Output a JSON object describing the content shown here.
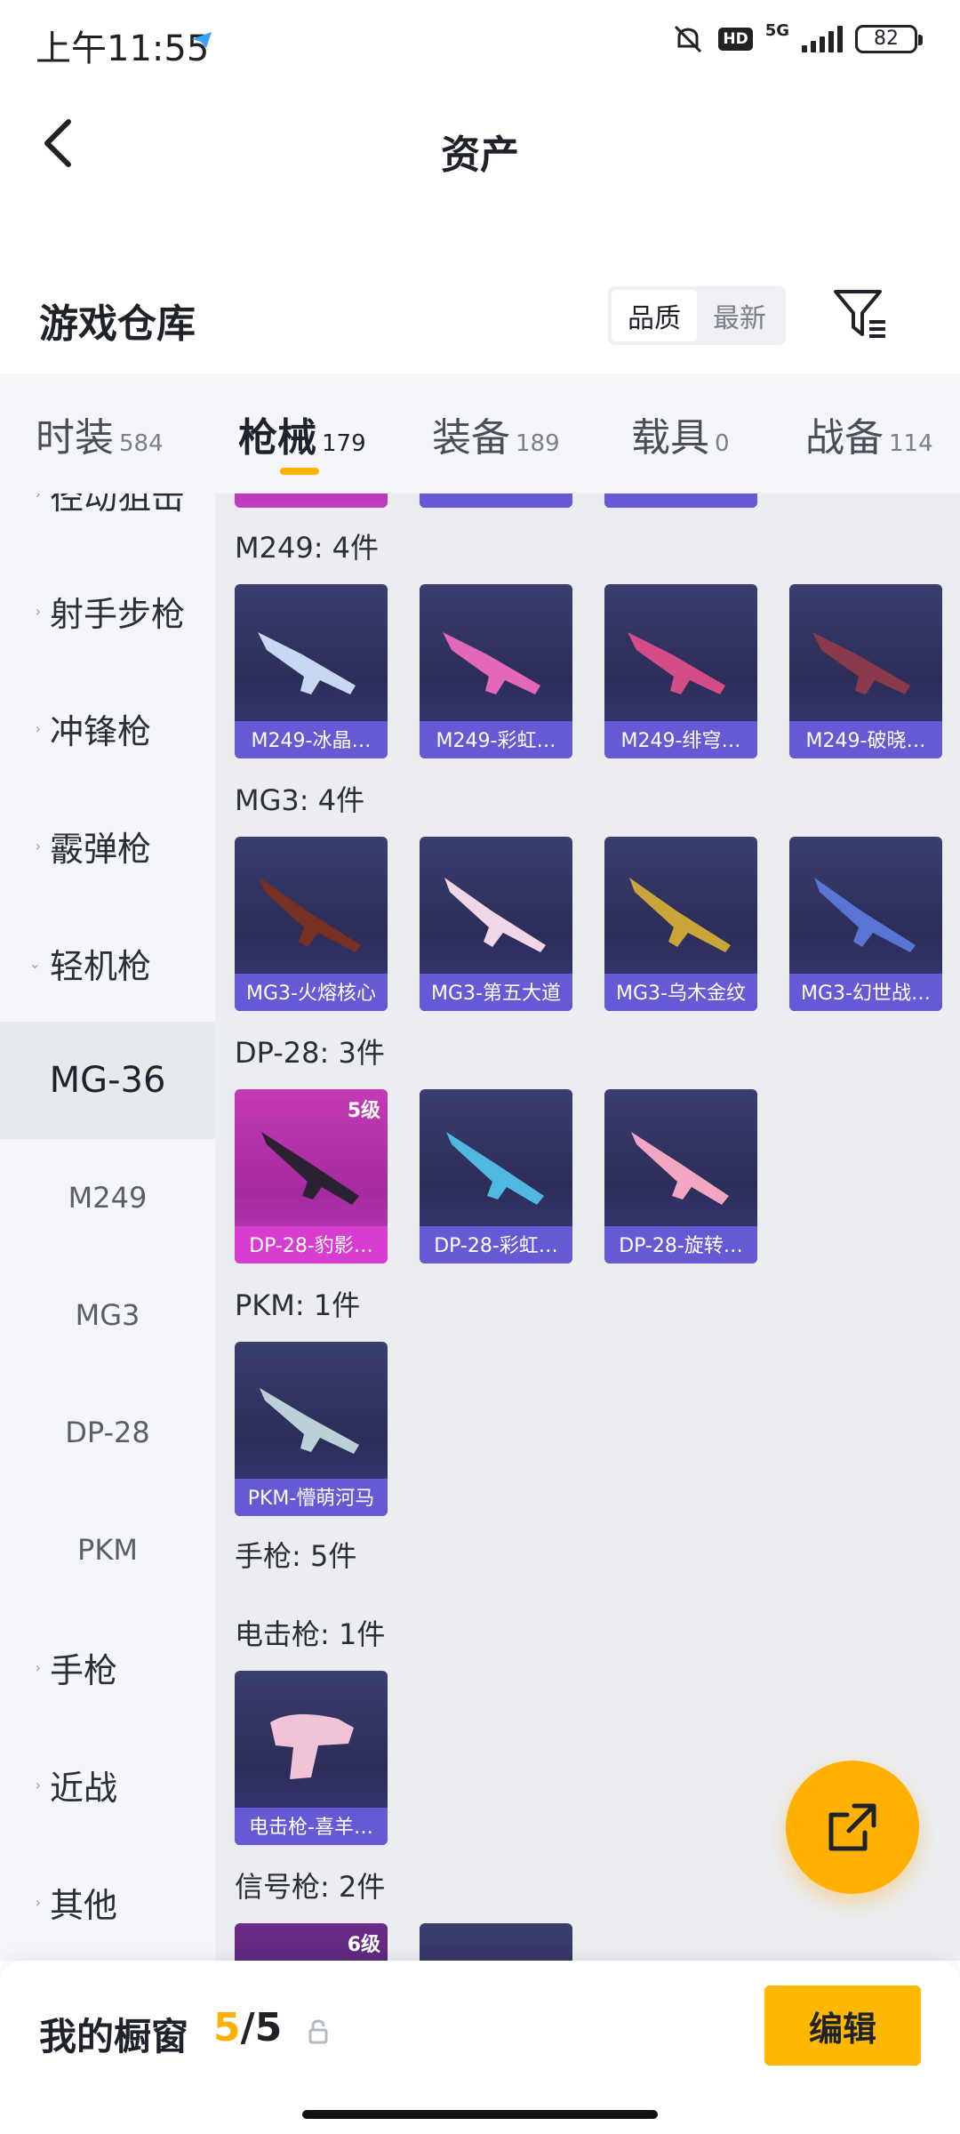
{
  "status_bar": {
    "time": "上午11:55",
    "hd": "HD",
    "network": "5G",
    "battery": "82"
  },
  "header": {
    "title": "资产"
  },
  "section": {
    "title": "游戏仓库",
    "sort_options": [
      "品质",
      "最新"
    ],
    "active_sort": "品质"
  },
  "tabs": [
    {
      "label": "时装",
      "count": "584"
    },
    {
      "label": "枪械",
      "count": "179",
      "active": true
    },
    {
      "label": "装备",
      "count": "189"
    },
    {
      "label": "载具",
      "count": "0"
    },
    {
      "label": "战备",
      "count": "114"
    }
  ],
  "sidebar": {
    "top_partial": "径动狙击",
    "items": [
      {
        "label": "射手步枪"
      },
      {
        "label": "冲锋枪"
      },
      {
        "label": "霰弹枪"
      },
      {
        "label": "轻机枪",
        "expanded": true
      },
      {
        "label": "手枪"
      },
      {
        "label": "近战"
      },
      {
        "label": "其他"
      }
    ],
    "subitems": [
      {
        "label": "MG-36",
        "active": true
      },
      {
        "label": "M249"
      },
      {
        "label": "MG3"
      },
      {
        "label": "DP-28"
      },
      {
        "label": "PKM"
      }
    ]
  },
  "groups": [
    {
      "title": "M249: 4件",
      "items": [
        {
          "name": "M249-冰晶…"
        },
        {
          "name": "M249-彩虹…"
        },
        {
          "name": "M249-绯穹…"
        },
        {
          "name": "M249-破晓…"
        }
      ]
    },
    {
      "title": "MG3: 4件",
      "items": [
        {
          "name": "MG3-火熔核心"
        },
        {
          "name": "MG3-第五大道"
        },
        {
          "name": "MG3-乌木金纹"
        },
        {
          "name": "MG3-幻世战…"
        }
      ]
    },
    {
      "title": "DP-28: 3件",
      "items": [
        {
          "name": "DP-28-豹影…",
          "level": "5级"
        },
        {
          "name": "DP-28-彩虹…"
        },
        {
          "name": "DP-28-旋转…"
        }
      ]
    },
    {
      "title": "PKM: 1件",
      "items": [
        {
          "name": "PKM-懵萌河马"
        }
      ]
    },
    {
      "title": "手枪: 5件",
      "items": []
    },
    {
      "title": "电击枪: 1件",
      "items": [
        {
          "name": "电击枪-喜羊…"
        }
      ]
    },
    {
      "title": "信号枪: 2件",
      "items": [
        {
          "level": "6级"
        }
      ]
    }
  ],
  "bottom_bar": {
    "label": "我的橱窗",
    "current": "5",
    "separator": "/",
    "max": "5",
    "edit_label": "编辑"
  },
  "colors": {
    "accent": "#ffb000",
    "card_bar": "#6a5cdc",
    "card_pink": "#c43ab3"
  }
}
